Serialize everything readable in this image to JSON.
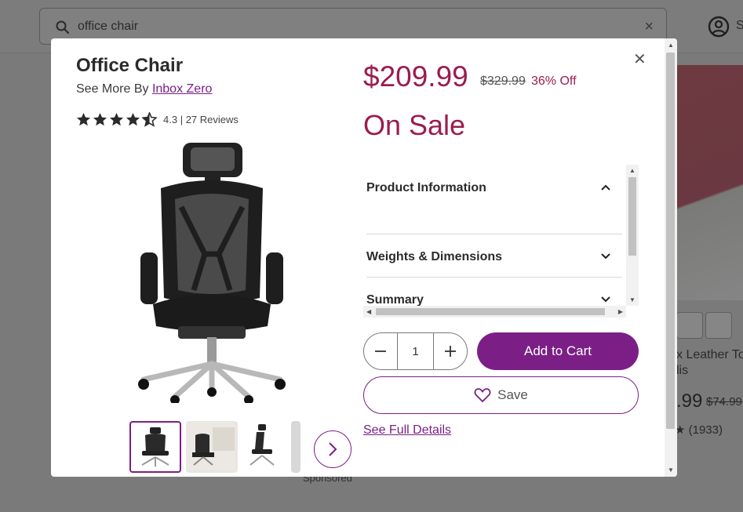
{
  "background": {
    "search": {
      "query": "office chair"
    },
    "account_initial": "S",
    "side_product": {
      "title_line1": "x Leather To",
      "title_line2": "lis",
      "price": ".99",
      "original_price": "$74.99",
      "reviews": "(1933)"
    },
    "sponsored_label": "Sponsored"
  },
  "modal": {
    "title": "Office Chair",
    "see_more_prefix": "See More By",
    "brand": "Inbox Zero",
    "rating": "4.3",
    "reviews": "27 Reviews",
    "rating_value": 4.3,
    "price": "$209.99",
    "original_price": "$329.99",
    "discount": "36% Off",
    "sale_label": "On Sale",
    "accordion": [
      {
        "label": "Product Information",
        "expanded": true
      },
      {
        "label": "Weights & Dimensions",
        "expanded": false
      },
      {
        "label": "Summary",
        "expanded": false
      }
    ],
    "quantity": "1",
    "add_to_cart": "Add to Cart",
    "save": "Save",
    "see_full_details": "See Full Details"
  },
  "colors": {
    "accent": "#7b1f86",
    "sale": "#9b1c4e"
  },
  "icons": [
    "search-icon",
    "clear-icon",
    "account-icon",
    "close-icon",
    "star-icon",
    "chevron-up-icon",
    "chevron-down-icon",
    "chevron-right-icon",
    "minus-icon",
    "plus-icon",
    "heart-icon"
  ]
}
